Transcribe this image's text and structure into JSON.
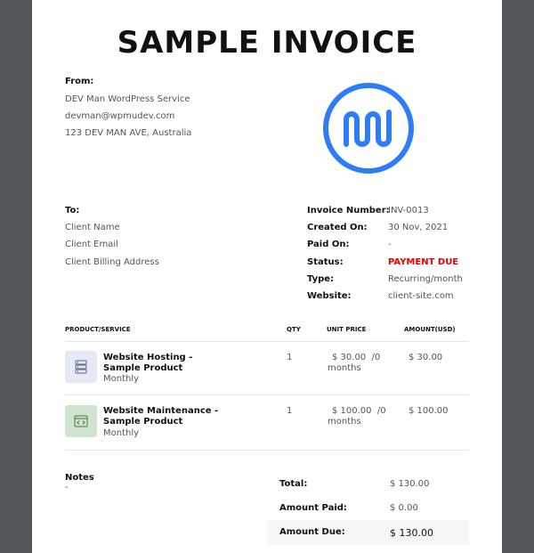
{
  "invoice_title": "SAMPLE INVOICE",
  "from": {
    "label": "From:",
    "name": "DEV Man WordPress Service",
    "email": "devman@wpmudev.com",
    "address": "123 DEV MAN AVE, Australia"
  },
  "logo": {
    "icon": "wpmudev-logo-icon",
    "color": "#2e7cf6"
  },
  "to": {
    "label": "To:",
    "name": "Client Name",
    "email": "Client Email",
    "address": "Client Billing Address"
  },
  "meta": {
    "invoice_number_label": "Invoice Number:",
    "invoice_number": "INV-0013",
    "created_label": "Created On:",
    "created": "30 Nov, 2021",
    "paid_label": "Paid On:",
    "paid": "-",
    "status_label": "Status:",
    "status": "PAYMENT DUE",
    "status_color": "#e00000",
    "type_label": "Type:",
    "type": "Recurring/month",
    "website_label": "Website:",
    "website": "client-site.com"
  },
  "table": {
    "headers": [
      "PRODUCT/SERVICE",
      "QTY",
      "UNIT PRICE",
      "AMOUNT(USD)"
    ],
    "rows": [
      {
        "icon": "server-icon",
        "icon_bg": "#e3e9f6",
        "name": "Website Hosting - Sample Product",
        "frequency": "Monthly",
        "qty": "1",
        "unit_price": "$ 30.00",
        "unit_suffix": "/0",
        "unit_period": "months",
        "amount": "$ 30.00"
      },
      {
        "icon": "code-window-icon",
        "icon_bg": "#cfe5cf",
        "name": "Website Maintenance - Sample Product",
        "frequency": "Monthly",
        "qty": "1",
        "unit_price": "$ 100.00",
        "unit_suffix": "/0",
        "unit_period": "months",
        "amount": "$ 100.00"
      }
    ]
  },
  "notes": {
    "label": "Notes",
    "value": "-"
  },
  "summary": {
    "total_label": "Total:",
    "total": "$ 130.00",
    "paid_label": "Amount Paid:",
    "paid": "$ 0.00",
    "due_label": "Amount Due:",
    "due": "$ 130.00"
  }
}
